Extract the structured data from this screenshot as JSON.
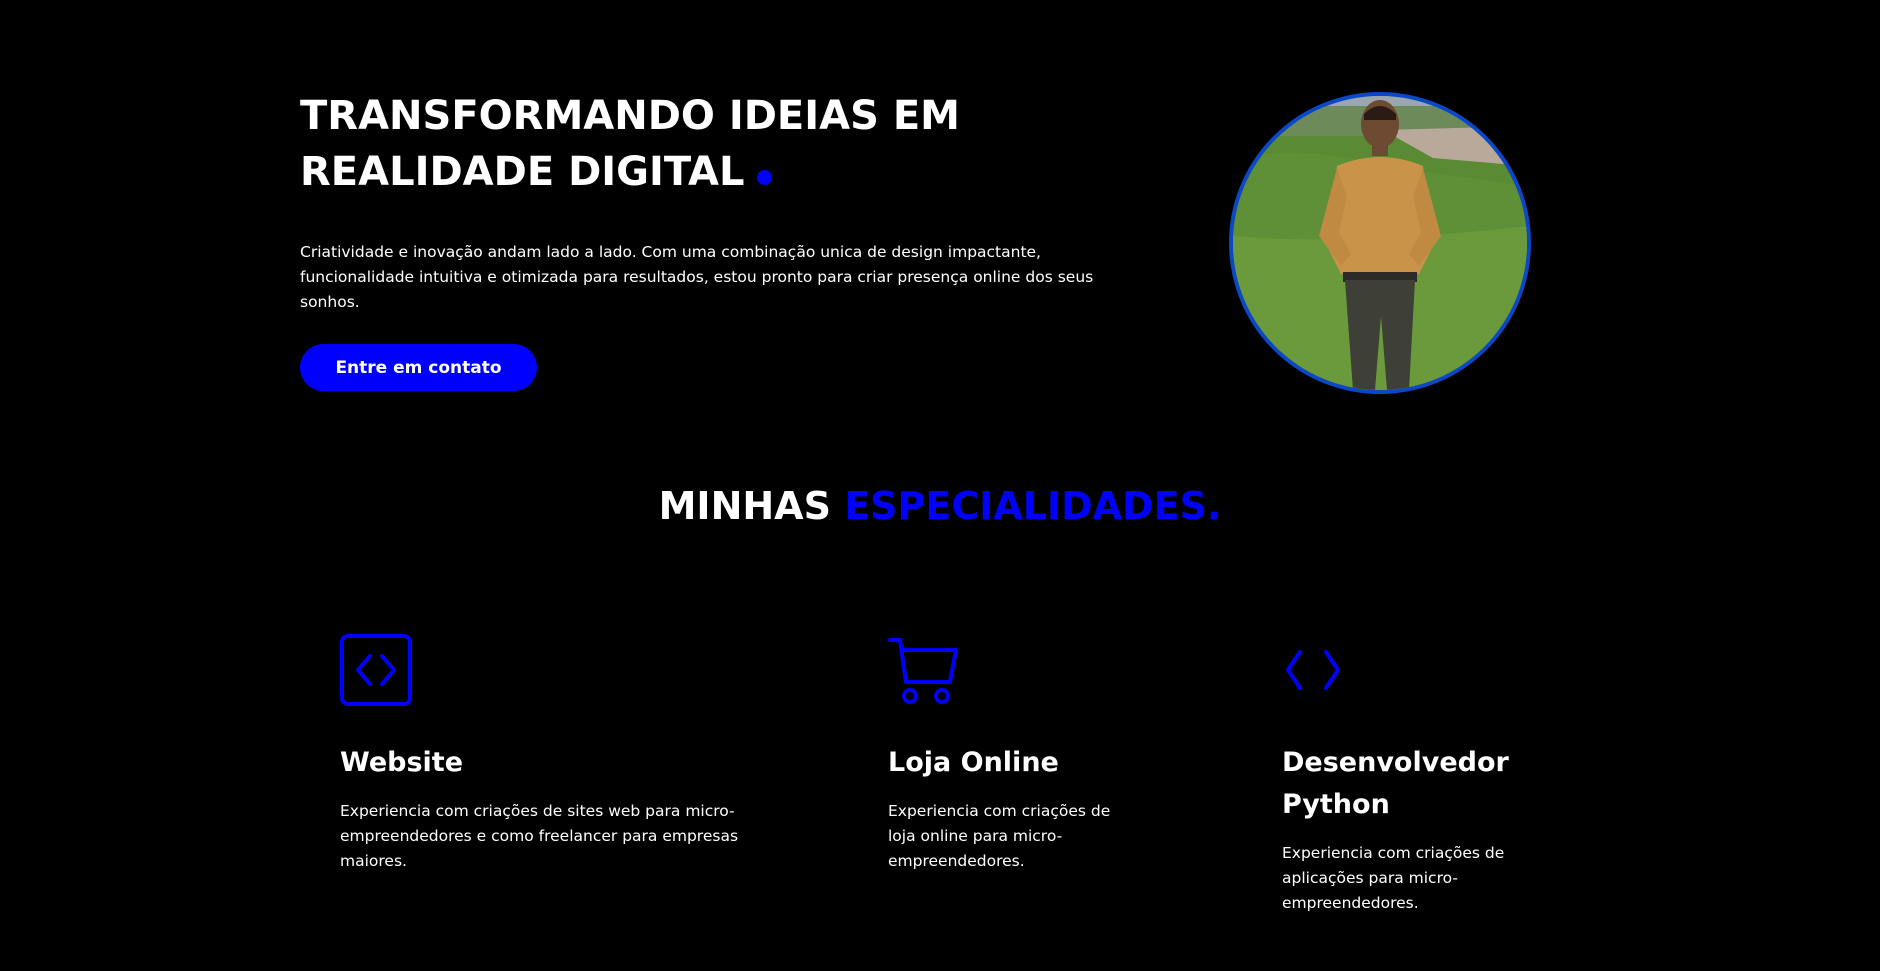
{
  "colors": {
    "background": "#000000",
    "accent": "#0000ff",
    "text": "#ffffff",
    "avatar_border": "#0a48c8"
  },
  "hero": {
    "title_line1": "TRANSFORMANDO IDEIAS EM",
    "title_line2": "REALIDADE DIGITAL",
    "description": "Criatividade e inovação andam lado a lado. Com uma combinação unica de design impactante, funcionalidade intuitiva e otimizada para resultados, estou pronto para criar presença online dos seus sonhos.",
    "cta_label": "Entre em contato",
    "avatar_icon": "profile-photo"
  },
  "specialties": {
    "title_white": "MINHAS ",
    "title_accent": "ESPECIALIDADES.",
    "items": [
      {
        "icon": "code-square-icon",
        "title": "Website",
        "description": "Experiencia com criações de sites web para micro-empreendedores e como freelancer para empresas maiores."
      },
      {
        "icon": "shopping-cart-icon",
        "title": "Loja Online",
        "description": "Experiencia com criações de loja online para micro-empreendedores."
      },
      {
        "icon": "code-brackets-icon",
        "title": "Desenvolvedor Python",
        "description": "Experiencia com criações de aplicações para micro-empreendedores."
      }
    ]
  }
}
